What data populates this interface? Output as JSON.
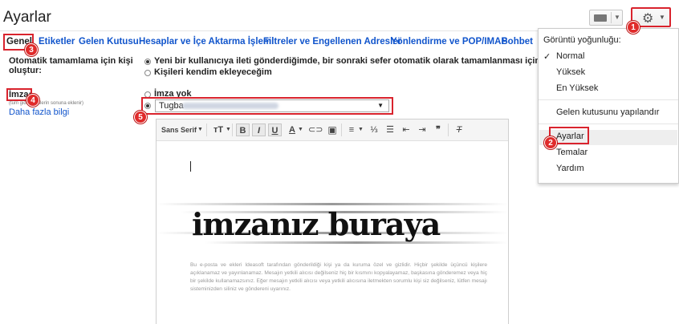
{
  "header": {
    "title": "Ayarlar"
  },
  "tabs": [
    {
      "label": "Genel",
      "active": true
    },
    {
      "label": "Etiketler"
    },
    {
      "label": "Gelen Kutusu"
    },
    {
      "label": "Hesaplar ve İçe Aktarma İşlemi"
    },
    {
      "label": "Filtreler ve Engellenen Adresler"
    },
    {
      "label": "Yönlendirme ve POP/IMAP"
    },
    {
      "label": "Sohbet"
    }
  ],
  "autocomplete": {
    "label": "Otomatik tamamlama için kişi oluştur:",
    "option1": "Yeni bir kullanıcıya ileti gönderdiğimde, bir sonraki sefer otomatik olarak tamamlanması için onları Diğ",
    "option2": "Kişileri kendim ekleyeceğim"
  },
  "signature": {
    "label": "İmza:",
    "hint": "(tüm giden iletilerin sonuna eklenir)",
    "more_link": "Daha fazla bilgi",
    "no_signature": "İmza yok",
    "account_value": "Tugba"
  },
  "editor": {
    "font": "Sans Serif",
    "signature_text": "imzanız buraya",
    "disclaimer": "Bu e-posta ve ekleri Ideasoft tarafından gönderildiği kişi ya da kuruma özel ve gizlidir. Hiçbir şekilde üçüncü kişilere açıklanamaz ve yayınlanamaz. Mesajın yetkili alıcısı değilseniz hiç bir kısmını kopyalayamaz, başkasına gönderemez veya hiç bir şekilde kullanamazsınız. Eğer mesajın yetkili alıcısı veya yetkili alıcısına iletmekten sorumlu kişi siz değilseniz, lütfen mesajı sisteminizden siliniz ve göndereni uyarınız."
  },
  "menu": {
    "density_header": "Görüntü yoğunluğu:",
    "density": [
      "Normal",
      "Yüksek",
      "En Yüksek"
    ],
    "configure_inbox": "Gelen kutusunu yapılandır",
    "settings": "Ayarlar",
    "themes": "Temalar",
    "help": "Yardım"
  },
  "badges": [
    "1",
    "2",
    "3",
    "4",
    "5"
  ],
  "colors": {
    "annotation": "#d9232d",
    "link": "#1155cc"
  }
}
